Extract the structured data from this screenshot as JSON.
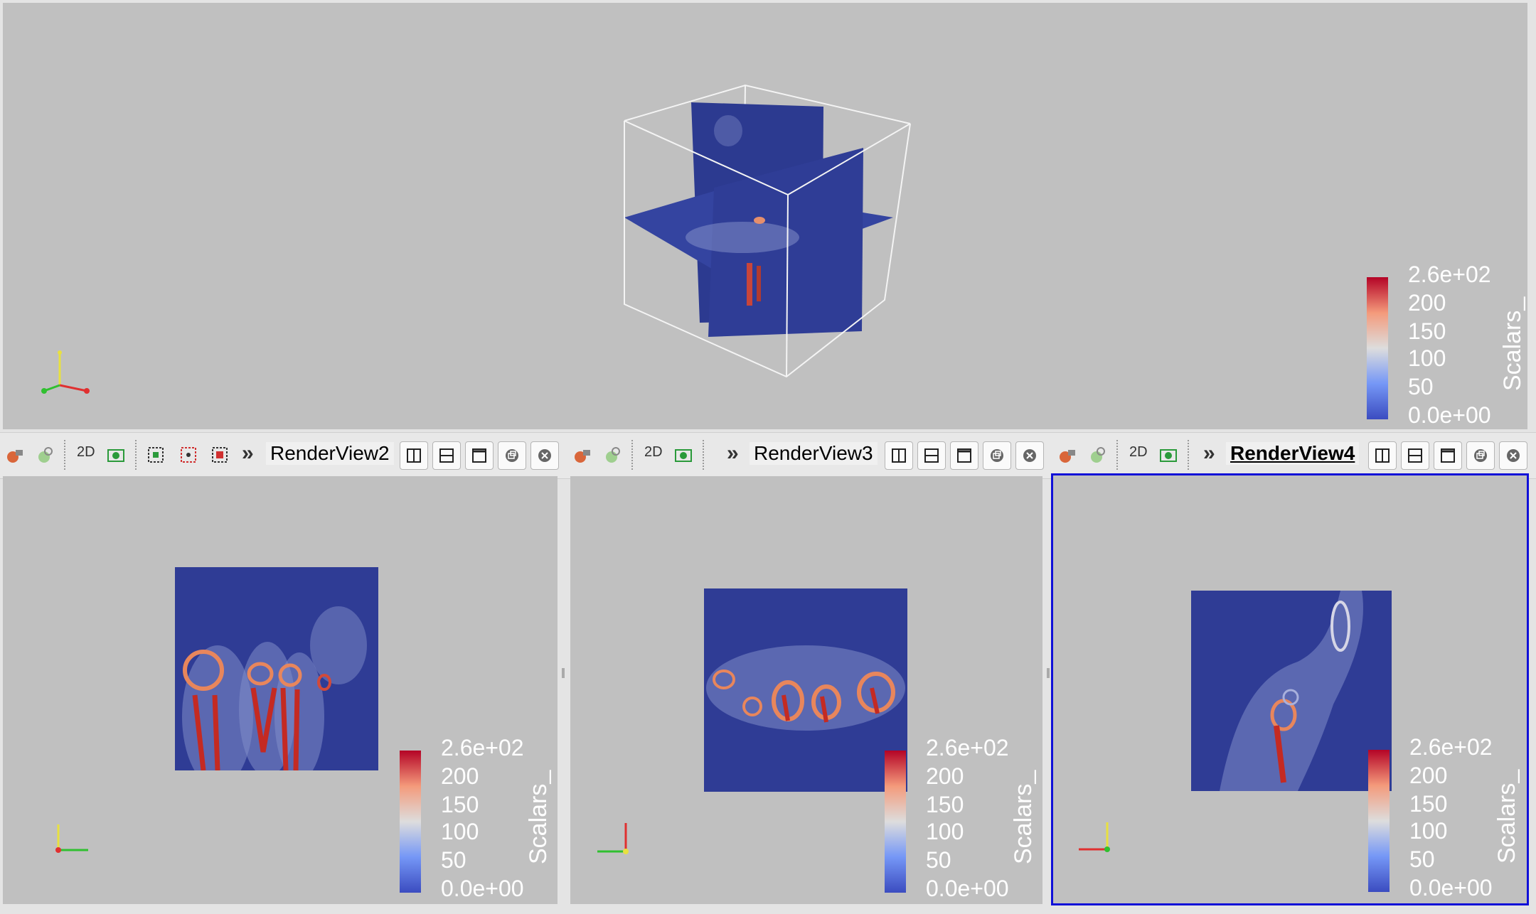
{
  "views": {
    "main": {
      "colorbar": {
        "title": "Scalars_",
        "labels": [
          "2.6e+02",
          "200",
          "150",
          "100",
          "50",
          "0.0e+00"
        ]
      },
      "axes": {
        "x": "X",
        "y": "Y",
        "z": "Z"
      }
    },
    "view2": {
      "toolbar": {
        "mode_label": "2D",
        "title": "RenderView2"
      },
      "colorbar": {
        "title": "Scalars_",
        "labels": [
          "2.6e+02",
          "200",
          "150",
          "100",
          "50",
          "0.0e+00"
        ]
      }
    },
    "view3": {
      "toolbar": {
        "mode_label": "2D",
        "title": "RenderView3"
      },
      "colorbar": {
        "title": "Scalars_",
        "labels": [
          "2.6e+02",
          "200",
          "150",
          "100",
          "50",
          "0.0e+00"
        ]
      }
    },
    "view4": {
      "toolbar": {
        "mode_label": "2D",
        "title": "RenderView4",
        "active": true
      },
      "colorbar": {
        "title": "Scalars_",
        "labels": [
          "2.6e+02",
          "200",
          "150",
          "100",
          "50",
          "0.0e+00"
        ]
      }
    }
  },
  "colors": {
    "background": "#c0c0c0",
    "slice": "#2f3c95",
    "active_border": "#1010d8",
    "colormap_high": "#b40426",
    "colormap_mid": "#dddddd",
    "colormap_low": "#3b4cc0"
  },
  "icons": [
    "reset-camera-icon",
    "zoom-to-data-icon",
    "camera-capture-icon",
    "select-cells-icon",
    "select-points-icon",
    "select-block-icon",
    "split-horizontal-icon",
    "split-vertical-icon",
    "maximize-icon",
    "restore-icon",
    "close-icon"
  ]
}
